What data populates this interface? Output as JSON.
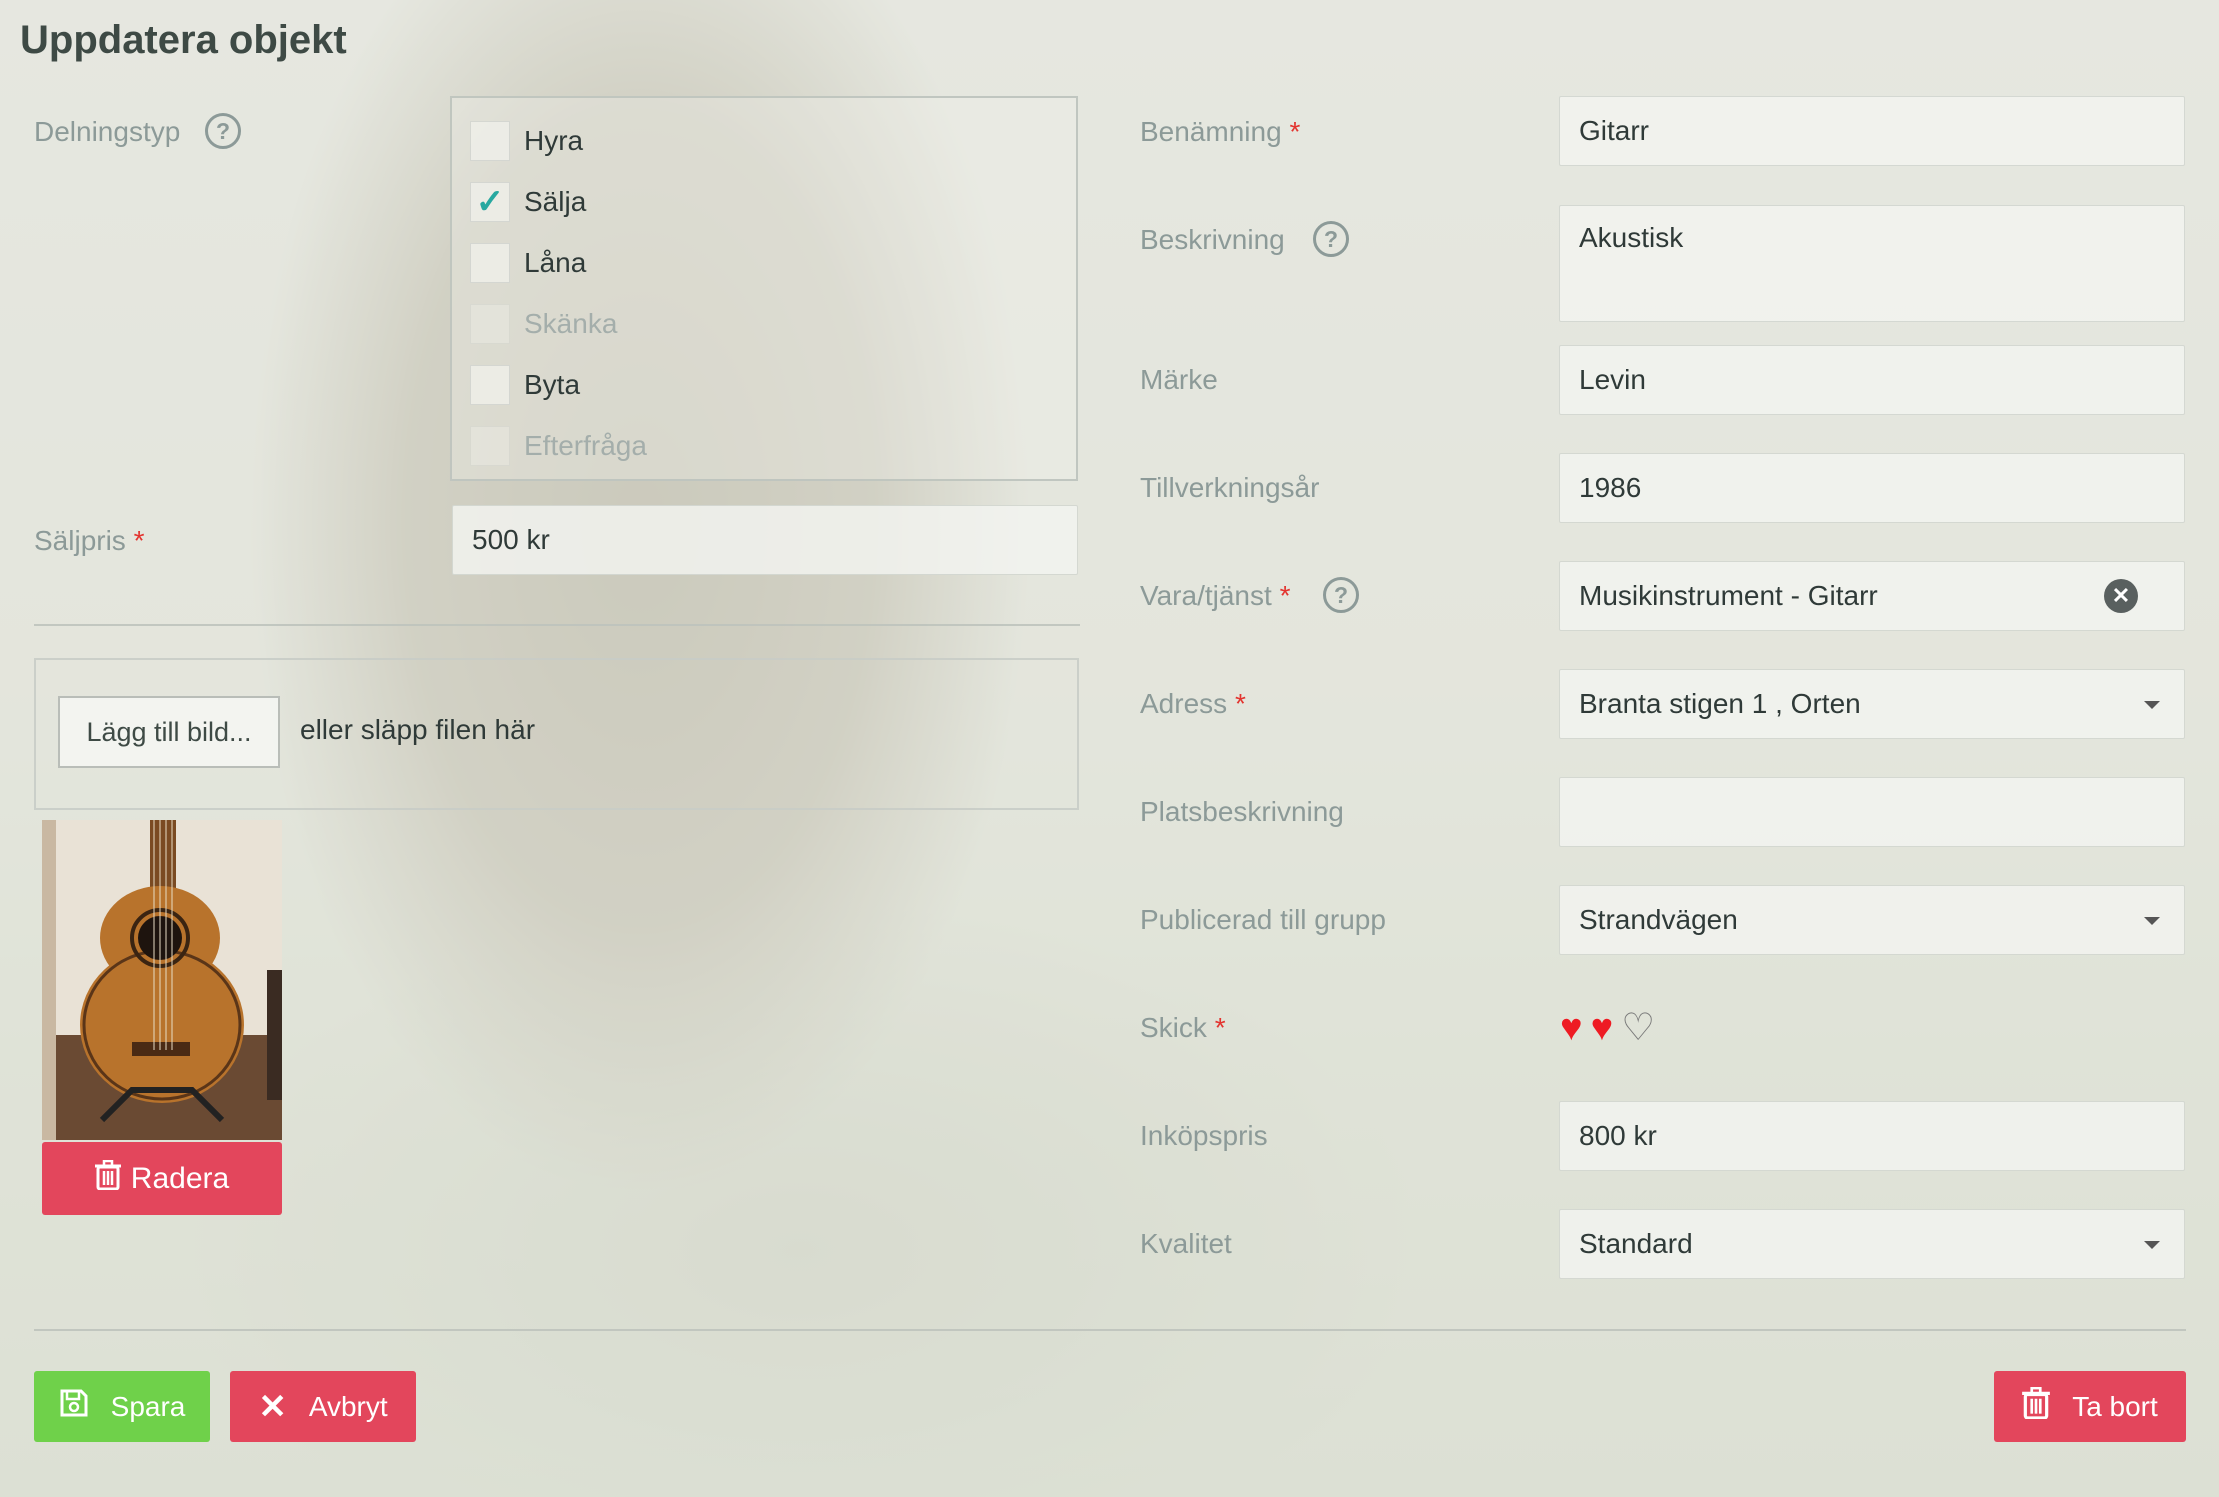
{
  "title": "Uppdatera objekt",
  "sharing": {
    "label": "Delningstyp",
    "options": [
      {
        "label": "Hyra",
        "checked": false,
        "disabled": false
      },
      {
        "label": "Sälja",
        "checked": true,
        "disabled": false
      },
      {
        "label": "Låna",
        "checked": false,
        "disabled": false
      },
      {
        "label": "Skänka",
        "checked": false,
        "disabled": true
      },
      {
        "label": "Byta",
        "checked": false,
        "disabled": false
      },
      {
        "label": "Efterfråga",
        "checked": false,
        "disabled": true
      }
    ]
  },
  "sale_price": {
    "label": "Säljpris",
    "value": "500 kr"
  },
  "upload": {
    "button": "Lägg till bild...",
    "hint": "eller släpp filen här"
  },
  "image": {
    "delete_label": "Radera"
  },
  "fields": {
    "name": {
      "label": "Benämning",
      "value": "Gitarr"
    },
    "description": {
      "label": "Beskrivning",
      "value": "Akustisk"
    },
    "brand": {
      "label": "Märke",
      "value": "Levin"
    },
    "year": {
      "label": "Tillverkningsår",
      "value": "1986"
    },
    "category": {
      "label": "Vara/tjänst",
      "value": "Musikinstrument - Gitarr"
    },
    "address": {
      "label": "Adress",
      "value": "Branta stigen 1 , Orten"
    },
    "place_description": {
      "label": "Platsbeskrivning",
      "value": ""
    },
    "group": {
      "label": "Publicerad till grupp",
      "value": "Strandvägen"
    },
    "condition": {
      "label": "Skick",
      "rating": 2,
      "max": 3
    },
    "purchase_price": {
      "label": "Inköpspris",
      "value": "800 kr"
    },
    "quality": {
      "label": "Kvalitet",
      "value": "Standard"
    }
  },
  "required_mark": "*",
  "help_glyph": "?",
  "actions": {
    "save": "Spara",
    "cancel": "Avbryt",
    "delete": "Ta bort"
  },
  "colors": {
    "save": "#6fd14a",
    "danger": "#e3465c",
    "check": "#27a8a0",
    "heart": "#ee1b23"
  }
}
